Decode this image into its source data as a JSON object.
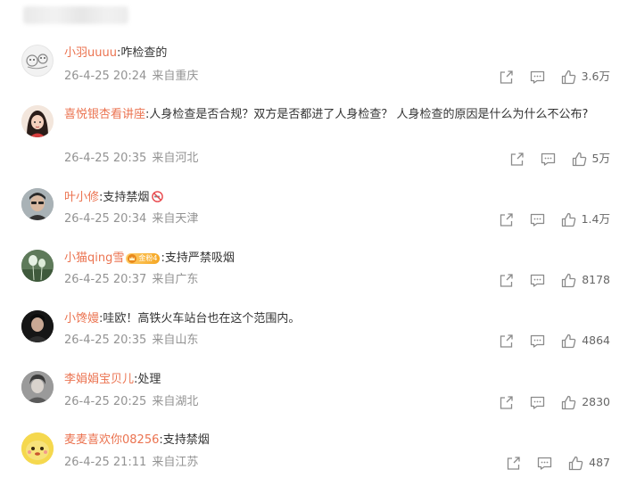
{
  "comments": [
    {
      "username": "小羽uuuu",
      "text": ":咋检查的",
      "time": "26-4-25 20:24",
      "location": "来自重庆",
      "likes": "3.6万",
      "avatar_icon": "cartoon-avatar"
    },
    {
      "username": "喜悦银杏看讲座",
      "text": ":人身检查是否合规？双方是否都进了人身检查？ 人身检查的原因是什么为什么不公布?",
      "time": "26-4-25 20:35",
      "location": "来自河北",
      "likes": "5万",
      "avatar_icon": "girl-avatar"
    },
    {
      "username": "叶小修",
      "text": ":支持禁烟",
      "emoji_icon": "no-smoking-icon",
      "time": "26-4-25 20:34",
      "location": "来自天津",
      "likes": "1.4万",
      "avatar_icon": "person-avatar"
    },
    {
      "username": "小猫qing雪",
      "badge": "金粉4",
      "text": ":支持严禁吸烟",
      "time": "26-4-25 20:37",
      "location": "来自广东",
      "likes": "8178",
      "avatar_icon": "plant-avatar"
    },
    {
      "username": "小馋嫚",
      "text": ":哇欧！高铁火车站台也在这个范围内。",
      "time": "26-4-25 20:35",
      "location": "来自山东",
      "likes": "4864",
      "avatar_icon": "dark-person-avatar"
    },
    {
      "username": "李娟娟宝贝儿",
      "text": ":处理",
      "time": "26-4-25 20:25",
      "location": "来自湖北",
      "likes": "2830",
      "avatar_icon": "gray-person-avatar"
    },
    {
      "username": "麦麦喜欢你08256",
      "text": ":支持禁烟",
      "time": "26-4-25 21:11",
      "location": "来自江苏",
      "likes": "487",
      "avatar_icon": "yellow-character-avatar"
    }
  ],
  "colors": {
    "username": "#eb7350",
    "text": "#333333",
    "meta": "#939393",
    "icon": "#8a8a8a"
  }
}
